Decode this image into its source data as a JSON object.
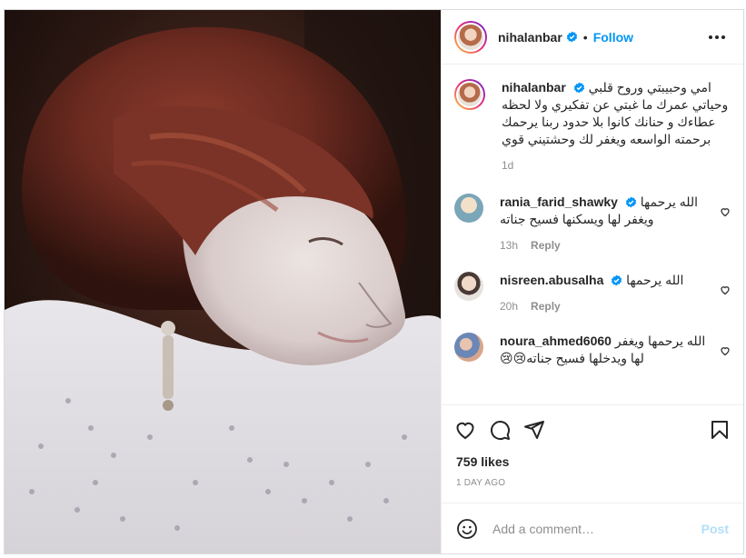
{
  "post": {
    "author": "nihalanbar",
    "follow_label": "Follow",
    "dot": "•",
    "caption": "امي وحبيبتي وروح قلبي وحياتي عمرك ما غبتي عن تفكيري ولا لحظه عطاءك و حنانك كانوا بلا حدود ربنا يرحمك برحمته الواسعه ويغفر لك وحشتيني قوي",
    "caption_age": "1d",
    "likes": "759 likes",
    "posted": "1 DAY AGO"
  },
  "comments": [
    {
      "user": "rania_farid_shawky",
      "verified": true,
      "text": "الله يرحمها ويغفر لها ويسكنها فسيح جناته",
      "age": "13h",
      "reply": "Reply"
    },
    {
      "user": "nisreen.abusalha",
      "verified": true,
      "text": "الله يرحمها",
      "age": "20h",
      "reply": "Reply"
    },
    {
      "user": "noura_ahmed6060",
      "verified": false,
      "text": "الله يرحمها ويغفر لها ويدخلها فسيح جناته😢😢",
      "age": "",
      "reply": ""
    }
  ],
  "composer": {
    "placeholder": "Add a comment…",
    "post_label": "Post"
  },
  "icons": {
    "verified": "verified-badge-icon",
    "more": "more-options-icon",
    "like": "heart-icon",
    "comment": "comment-icon",
    "share": "share-icon",
    "save": "bookmark-icon",
    "emoji": "emoji-icon"
  },
  "colors": {
    "accent": "#0095f6",
    "muted": "#8e8e8e",
    "border": "#dbdbdb",
    "post_disabled": "#b2dffc"
  }
}
